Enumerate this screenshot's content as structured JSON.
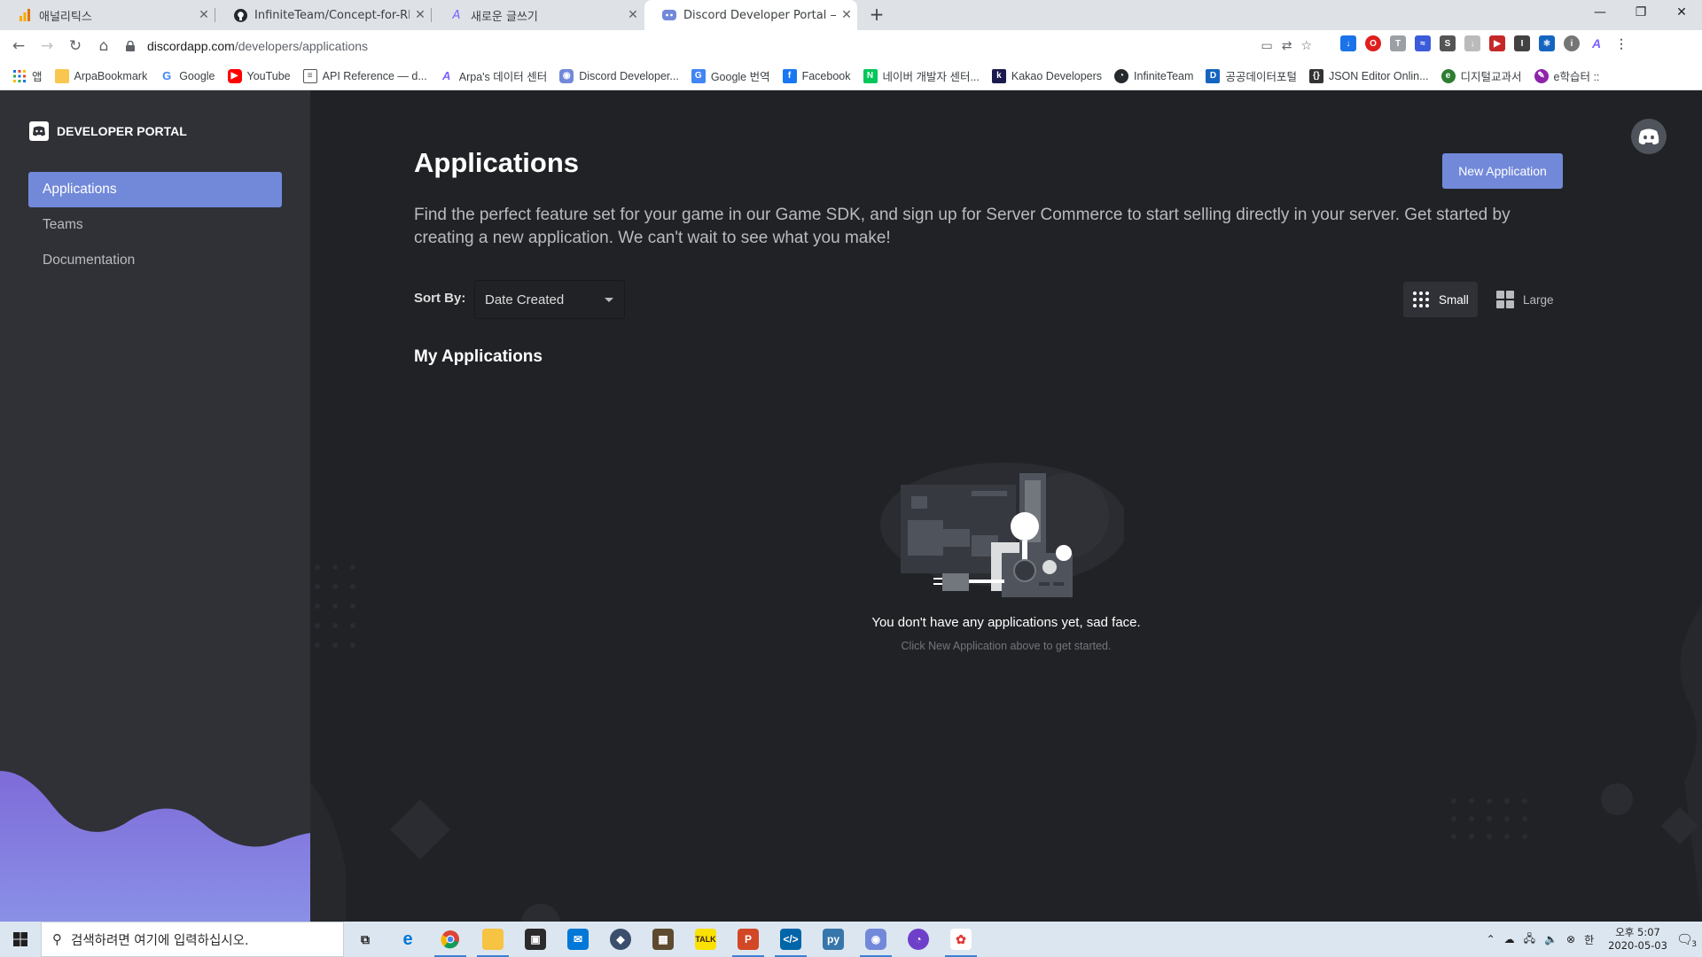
{
  "browser": {
    "tabs": [
      {
        "title": "애널리틱스",
        "favicon": "analytics-icon"
      },
      {
        "title": "InfiniteTeam/Concept-for-RPG-B",
        "favicon": "github-icon"
      },
      {
        "title": "새로운 글쓰기",
        "favicon": "arpa-icon"
      },
      {
        "title": "Discord Developer Portal — My",
        "favicon": "discord-icon",
        "active": true
      }
    ],
    "url_host": "discordapp.com",
    "url_path": "/developers/applications",
    "bookmarks": [
      {
        "label": "앱",
        "icon": "apps-grid-icon"
      },
      {
        "label": "ArpaBookmark",
        "icon": "folder-icon"
      },
      {
        "label": "Google",
        "icon": "google-icon"
      },
      {
        "label": "YouTube",
        "icon": "youtube-icon"
      },
      {
        "label": "API Reference — d...",
        "icon": "doc-icon"
      },
      {
        "label": "Arpa's 데이터 센터",
        "icon": "arpa-icon"
      },
      {
        "label": "Discord Developer...",
        "icon": "discord-icon"
      },
      {
        "label": "Google 번역",
        "icon": "translate-icon"
      },
      {
        "label": "Facebook",
        "icon": "facebook-icon"
      },
      {
        "label": "네이버 개발자 센터...",
        "icon": "naver-icon"
      },
      {
        "label": "Kakao Developers",
        "icon": "kakao-icon"
      },
      {
        "label": "InfiniteTeam",
        "icon": "github-icon"
      },
      {
        "label": "공공데이터포털",
        "icon": "data-portal-icon"
      },
      {
        "label": "JSON Editor Onlin...",
        "icon": "json-icon"
      },
      {
        "label": "디지털교과서",
        "icon": "textbook-icon"
      },
      {
        "label": "e학습터 ::",
        "icon": "elearning-icon"
      }
    ]
  },
  "sidebar": {
    "brand": "DEVELOPER PORTAL",
    "items": [
      {
        "label": "Applications",
        "active": true
      },
      {
        "label": "Teams"
      },
      {
        "label": "Documentation"
      }
    ]
  },
  "main": {
    "title": "Applications",
    "new_app_label": "New Application",
    "description": "Find the perfect feature set for your game in our Game SDK, and sign up for Server Commerce to start selling directly in your server. Get started by creating a new application. We can't wait to see what you make!",
    "sort_label": "Sort By:",
    "sort_value": "Date Created",
    "view_small": "Small",
    "view_large": "Large",
    "section_title": "My Applications",
    "empty_title": "You don't have any applications yet, sad face.",
    "empty_subtitle": "Click New Application above to get started."
  },
  "taskbar": {
    "search_placeholder": "검색하려면 여기에 입력하십시오.",
    "ime": "한",
    "time_line1": "오후 5:07",
    "time_line2": "2020-05-03",
    "notification_count": "3"
  },
  "colors": {
    "blurple": "#7289da",
    "sidebar_bg": "#2f3136",
    "page_bg": "#202225"
  }
}
